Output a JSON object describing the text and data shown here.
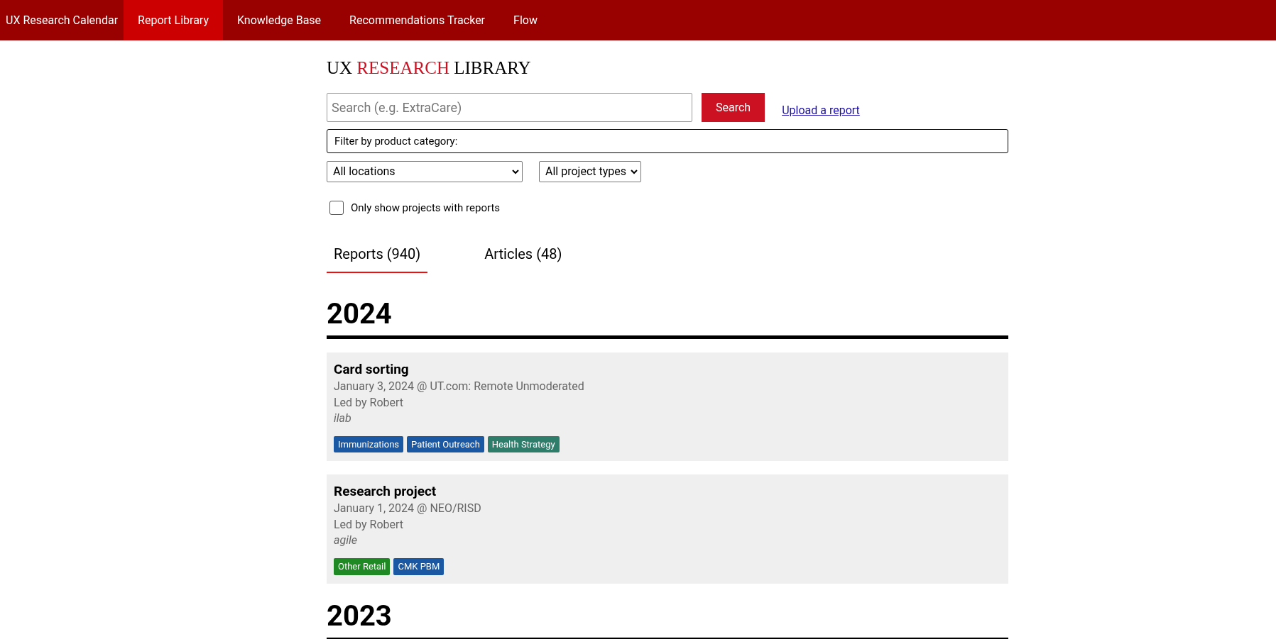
{
  "nav": [
    {
      "label": "UX Research Calendar",
      "selected": false
    },
    {
      "label": "Report Library",
      "selected": true
    },
    {
      "label": "Knowledge Base",
      "selected": false
    },
    {
      "label": "Recommendations Tracker",
      "selected": false
    },
    {
      "label": "Flow",
      "selected": false
    }
  ],
  "title": [
    {
      "text": "UX",
      "accent": false
    },
    {
      "text": "RESEARCH",
      "accent": true
    },
    {
      "text": "LIBRARY",
      "accent": false
    }
  ],
  "search": {
    "placeholder": "Search (e.g. ExtraCare)",
    "button": "Search",
    "upload_link": "Upload a report"
  },
  "category_filter": {
    "label": "Filter by product category:"
  },
  "selects": [
    {
      "value": "All locations",
      "wide": true
    },
    {
      "value": "All project types",
      "wide": false
    }
  ],
  "reports_only": {
    "label": "Only show projects with reports",
    "checked": false
  },
  "tabs": [
    {
      "label": "Reports (940)",
      "selected": true
    },
    {
      "label": "Articles (48)",
      "selected": false
    }
  ],
  "years": [
    {
      "year": "2024",
      "projects": [
        {
          "title": "Card sorting",
          "date": "January 3, 2024 @ UT.com: Remote Unmoderated",
          "lead": "Led by Robert",
          "team": "ilab",
          "tags": [
            {
              "label": "Immunizations",
              "color": "#1a58a3"
            },
            {
              "label": "Patient Outreach",
              "color": "#1a58a3"
            },
            {
              "label": "Health Strategy",
              "color": "#2e7d6b"
            }
          ]
        },
        {
          "title": "Research project",
          "date": "January 1, 2024 @ NEO/RISD",
          "lead": "Led by Robert",
          "team": "agile",
          "tags": [
            {
              "label": "Other Retail",
              "color": "#1f8a24"
            },
            {
              "label": "CMK PBM",
              "color": "#1a58a3"
            }
          ]
        }
      ]
    },
    {
      "year": "2023"
    }
  ]
}
